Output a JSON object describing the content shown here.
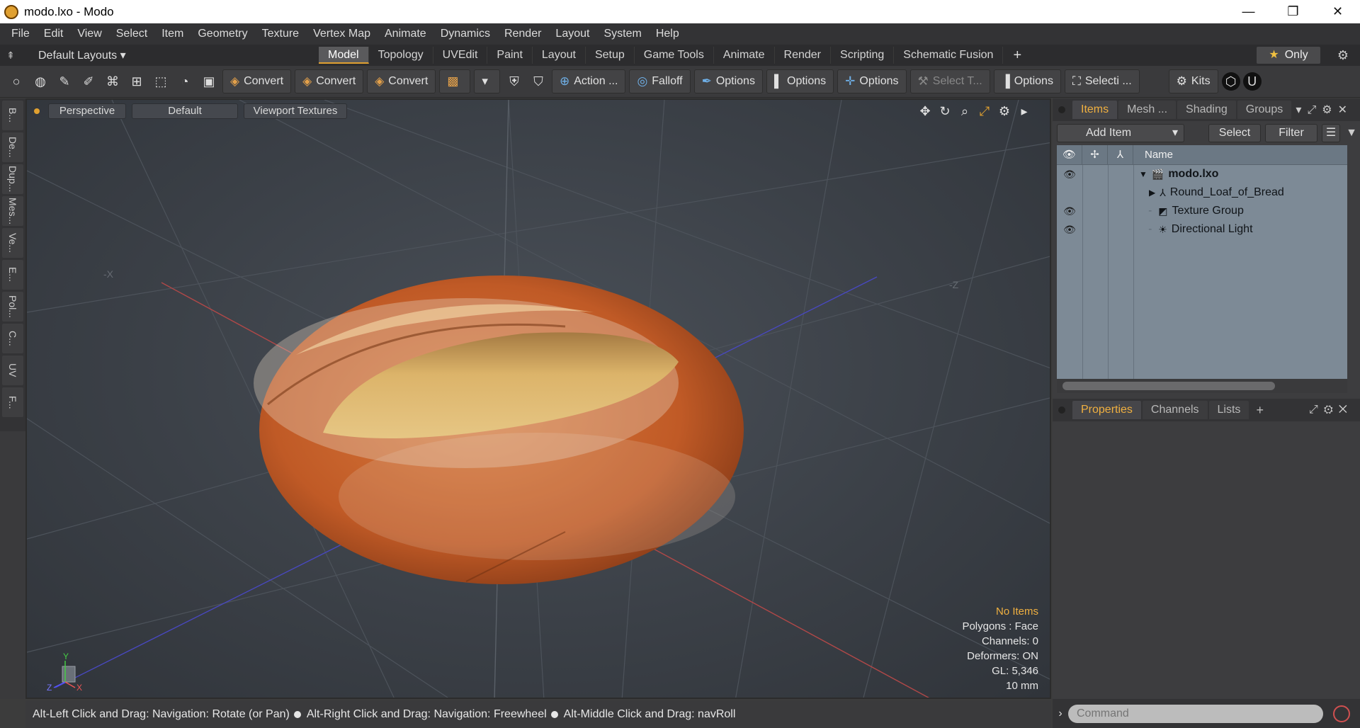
{
  "window": {
    "title": "modo.lxo - Modo",
    "minimize": "—",
    "restore": "❐",
    "close": "✕"
  },
  "menu": [
    "File",
    "Edit",
    "View",
    "Select",
    "Item",
    "Geometry",
    "Texture",
    "Vertex Map",
    "Animate",
    "Dynamics",
    "Render",
    "Layout",
    "System",
    "Help"
  ],
  "layoutbar": {
    "layouts_label": "Default Layouts ▾",
    "tabs": [
      "Model",
      "Topology",
      "UVEdit",
      "Paint",
      "Layout",
      "Setup",
      "Game Tools",
      "Animate",
      "Render",
      "Scripting",
      "Schematic Fusion"
    ],
    "active_tab": "Model",
    "only_label": "Only"
  },
  "toolbar": {
    "convert_1": "Convert",
    "convert_2": "Convert",
    "convert_3": "Convert",
    "action": "Action ...",
    "falloff": "Falloff",
    "options_1": "Options",
    "options_2": "Options",
    "options_3": "Options",
    "options_4": "Options",
    "select_t": "Select T...",
    "selecti": "Selecti ...",
    "kits": "Kits"
  },
  "left_tabs": [
    "B...",
    "De...",
    "Dup...",
    "Mes...",
    "Ve...",
    "E...",
    "Pol...",
    "C...",
    "UV",
    "F..."
  ],
  "viewport": {
    "perspective": "Perspective",
    "default": "Default",
    "textures": "Viewport Textures",
    "axis_x": "-X",
    "axis_z": "-Z",
    "info": {
      "no_items": "No Items",
      "polygons": "Polygons : Face",
      "channels": "Channels: 0",
      "deformers": "Deformers: ON",
      "gl": "GL: 5,346",
      "size": "10 mm"
    },
    "gizmo": {
      "y": "Y",
      "z": "Z",
      "x": "X"
    },
    "colors": {
      "bread_crust": "#c4622c",
      "bread_inner": "#d9ad64",
      "grid_red": "#c05050",
      "grid_blue": "#5050c8"
    }
  },
  "status": {
    "hint1": "Alt-Left Click and Drag: Navigation: Rotate (or Pan)",
    "hint2": "Alt-Right Click and Drag: Navigation: Freewheel",
    "hint3": "Alt-Middle Click and Drag: navRoll"
  },
  "items_panel": {
    "tabs": [
      "Items",
      "Mesh ...",
      "Shading",
      "Groups"
    ],
    "add_item": "Add Item",
    "select": "Select",
    "filter": "Filter",
    "col_name": "Name",
    "rows": [
      {
        "name": "modo.lxo",
        "visible": true,
        "indent": 0
      },
      {
        "name": "Round_Loaf_of_Bread",
        "visible": false,
        "indent": 1
      },
      {
        "name": "Texture Group",
        "visible": true,
        "indent": 1
      },
      {
        "name": "Directional Light",
        "visible": true,
        "indent": 1
      }
    ]
  },
  "props_panel": {
    "tabs": [
      "Properties",
      "Channels",
      "Lists"
    ]
  },
  "command": {
    "placeholder": "Command"
  }
}
